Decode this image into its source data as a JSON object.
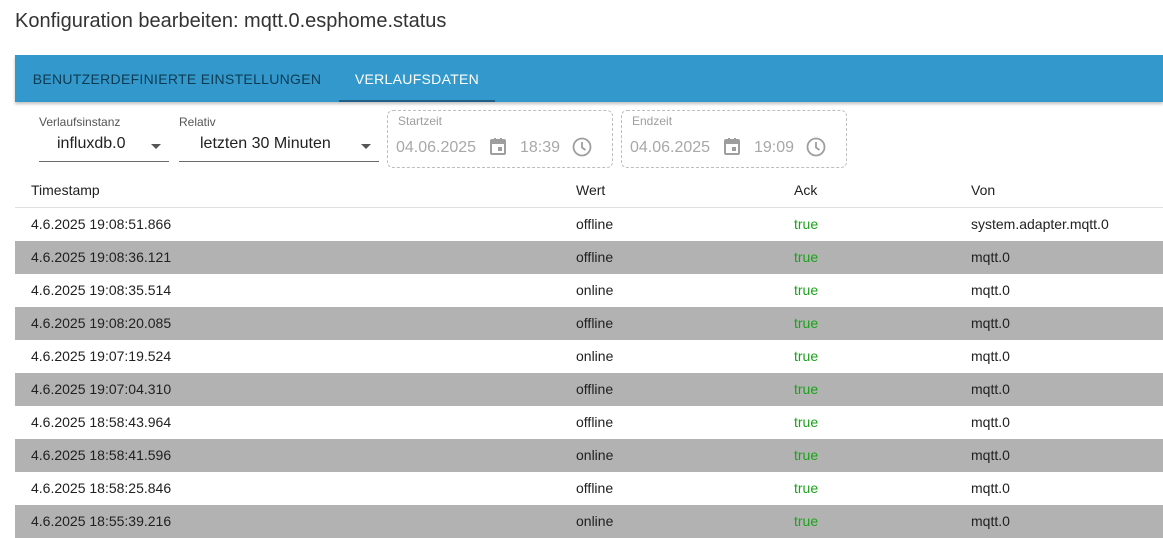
{
  "page": {
    "title": "Konfiguration bearbeiten: mqtt.0.esphome.status"
  },
  "tabs": [
    {
      "label": "BENUTZERDEFINIERTE EINSTELLUNGEN",
      "active": false
    },
    {
      "label": "VERLAUFSDATEN",
      "active": true
    }
  ],
  "filters": {
    "instance": {
      "label": "Verlaufsinstanz",
      "value": "influxdb.0"
    },
    "relative": {
      "label": "Relativ",
      "value": "letzten 30 Minuten"
    },
    "start": {
      "label": "Startzeit",
      "date": "04.06.2025",
      "time": "18:39"
    },
    "end": {
      "label": "Endzeit",
      "date": "04.06.2025",
      "time": "19:09"
    }
  },
  "table": {
    "headers": [
      "Timestamp",
      "Wert",
      "Ack",
      "Von"
    ],
    "rows": [
      [
        "4.6.2025 19:08:51.866",
        "offline",
        "true",
        "system.adapter.mqtt.0"
      ],
      [
        "4.6.2025 19:08:36.121",
        "offline",
        "true",
        "mqtt.0"
      ],
      [
        "4.6.2025 19:08:35.514",
        "online",
        "true",
        "mqtt.0"
      ],
      [
        "4.6.2025 19:08:20.085",
        "offline",
        "true",
        "mqtt.0"
      ],
      [
        "4.6.2025 19:07:19.524",
        "online",
        "true",
        "mqtt.0"
      ],
      [
        "4.6.2025 19:07:04.310",
        "offline",
        "true",
        "mqtt.0"
      ],
      [
        "4.6.2025 18:58:43.964",
        "offline",
        "true",
        "mqtt.0"
      ],
      [
        "4.6.2025 18:58:41.596",
        "online",
        "true",
        "mqtt.0"
      ],
      [
        "4.6.2025 18:58:25.846",
        "offline",
        "true",
        "mqtt.0"
      ],
      [
        "4.6.2025 18:55:39.216",
        "online",
        "true",
        "mqtt.0"
      ]
    ]
  },
  "colors": {
    "tabbar": "#3399cc",
    "ack_true": "#19a319",
    "row_stripe": "#b2b2b2"
  }
}
